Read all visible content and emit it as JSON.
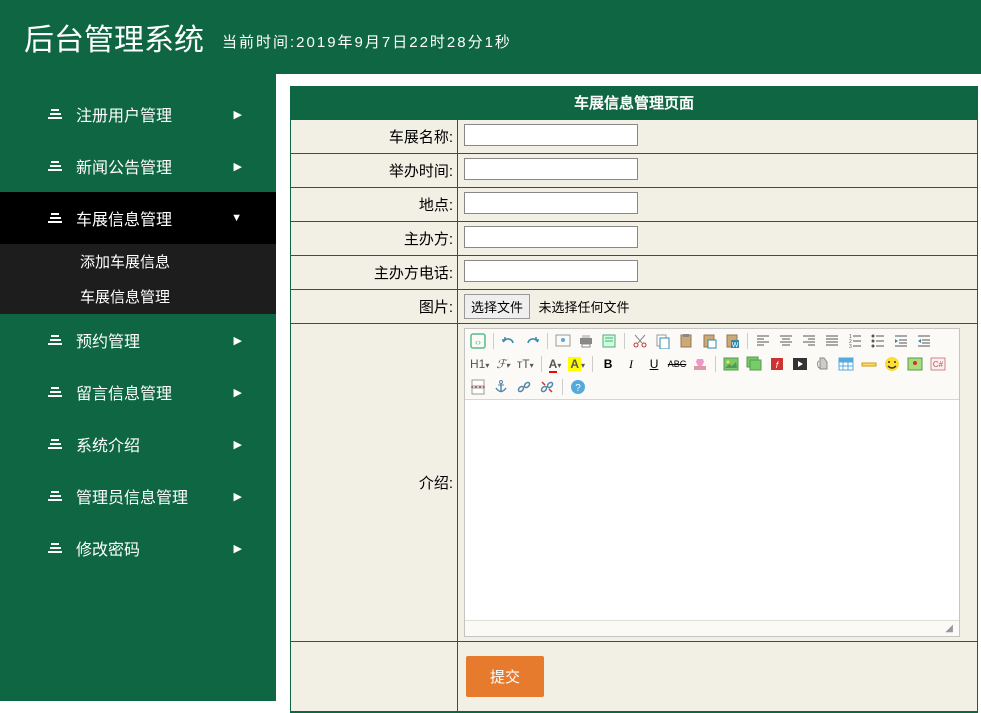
{
  "header": {
    "title": "后台管理系统",
    "time_label": "当前时间:2019年9月7日22时28分1秒"
  },
  "sidebar": {
    "items": [
      {
        "label": "注册用户管理"
      },
      {
        "label": "新闻公告管理"
      },
      {
        "label": "车展信息管理",
        "sub": [
          "添加车展信息",
          "车展信息管理"
        ]
      },
      {
        "label": "预约管理"
      },
      {
        "label": "留言信息管理"
      },
      {
        "label": "系统介绍"
      },
      {
        "label": "管理员信息管理"
      },
      {
        "label": "修改密码"
      }
    ]
  },
  "panel": {
    "title": "车展信息管理页面",
    "fields": {
      "name": "车展名称:",
      "time": "举办时间:",
      "place": "地点:",
      "host": "主办方:",
      "phone": "主办方电话:",
      "image": "图片:",
      "intro": "介绍:"
    },
    "file": {
      "button": "选择文件",
      "status": "未选择任何文件"
    },
    "submit": "提交"
  },
  "editor": {
    "h1": "H1",
    "font": "ℱ",
    "size": "ᴛT",
    "fg": "A",
    "bg": "A",
    "bold": "B",
    "italic": "I",
    "underline": "U",
    "strike": "ABC"
  }
}
